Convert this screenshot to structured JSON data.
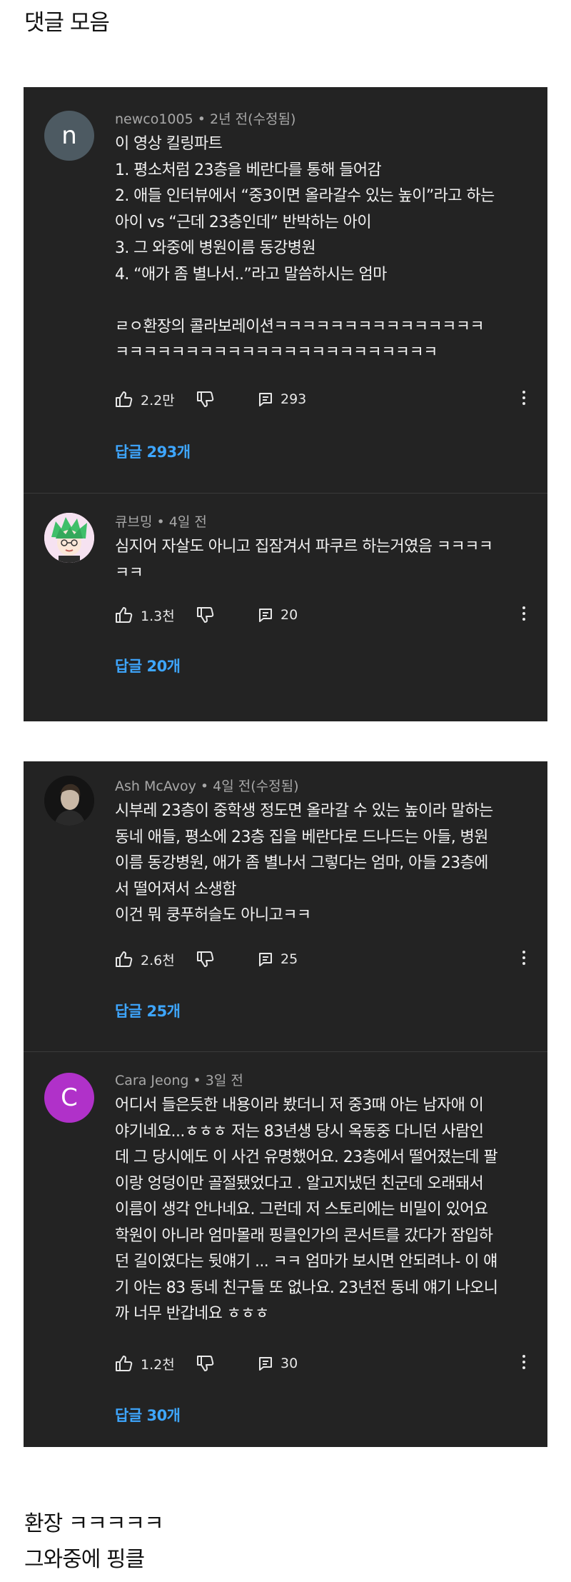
{
  "page": {
    "title": "댓글 모음",
    "caption_line1": "환장 ㅋㅋㅋㅋㅋ",
    "caption_line2": "그와중에 핑클"
  },
  "colors": {
    "panel_bg": "#232323",
    "reply_link": "#3ea6ff",
    "avatar_n": "#4d5a62",
    "avatar_c": "#b031c9"
  },
  "comments": [
    {
      "author": "newco1005",
      "time": "2년 전(수정됨)",
      "avatar_letter": "n",
      "avatar_kind": "letter",
      "text": "이 영상 킬링파트\n1. 평소처럼 23층을 베란다를 통해 들어감\n2. 애들 인터뷰에서 “중3이면 올라갈수 있는 높이”라고 하는\n아이 vs “근데 23층인데” 반박하는 아이\n3. 그 와중에 병원이름 동강병원\n4. “애가 좀 별나서..”라고 말씀하시는 엄마\n\nㄹㅇ환장의 콜라보레이션ㅋㅋㅋㅋㅋㅋㅋㅋㅋㅋㅋㅋㅋㅋㅋ\nㅋㅋㅋㅋㅋㅋㅋㅋㅋㅋㅋㅋㅋㅋㅋㅋㅋㅋㅋㅋㅋㅋㅋ",
      "likes": "2.2만",
      "reply_count": "293",
      "replies_label": "답글 293개"
    },
    {
      "author": "큐브밍",
      "time": "4일 전",
      "avatar_kind": "character",
      "text": "심지어 자살도 아니고 집잠겨서 파쿠르 하는거였음 ㅋㅋㅋㅋ\nㅋㅋ",
      "likes": "1.3천",
      "reply_count": "20",
      "replies_label": "답글 20개"
    },
    {
      "author": "Ash McAvoy",
      "time": "4일 전(수정됨)",
      "avatar_kind": "photo",
      "text": "시부레 23층이 중학생 정도면 올라갈 수 있는 높이라 말하는\n동네 애들, 평소에 23층 집을 베란다로 드나드는 아들, 병원\n이름 동강병원, 애가 좀 별나서 그렇다는 엄마, 아들 23층에\n서 떨어져서 소생함\n이건 뭐 쿵푸허슬도 아니고ㅋㅋ",
      "likes": "2.6천",
      "reply_count": "25",
      "replies_label": "답글 25개"
    },
    {
      "author": "Cara Jeong",
      "time": "3일 전",
      "avatar_letter": "C",
      "avatar_kind": "letter",
      "text": "어디서 들은듯한 내용이라 봤더니 저 중3때 아는 남자애 이\n야기네요...ㅎㅎㅎ 저는 83년생 당시 옥동중 다니던 사람인\n데 그 당시에도 이 사건 유명했어요. 23층에서 떨어졌는데 팔\n이랑 엉덩이만 골절됐었다고 . 알고지냈던 친군데 오래돼서\n이름이 생각 안나네요. 그런데 저 스토리에는 비밀이 있어요\n학원이 아니라 엄마몰래 핑클인가의 콘서트를 갔다가 잠입하\n던 길이였다는 뒷얘기 ... ㅋㅋ 엄마가 보시면 안되려나- 이 얘\n기 아는 83 동네 친구들 또 없나요. 23년전 동네 얘기 나오니\n까 너무 반갑네요 ㅎㅎㅎ",
      "likes": "1.2천",
      "reply_count": "30",
      "replies_label": "답글 30개"
    }
  ]
}
